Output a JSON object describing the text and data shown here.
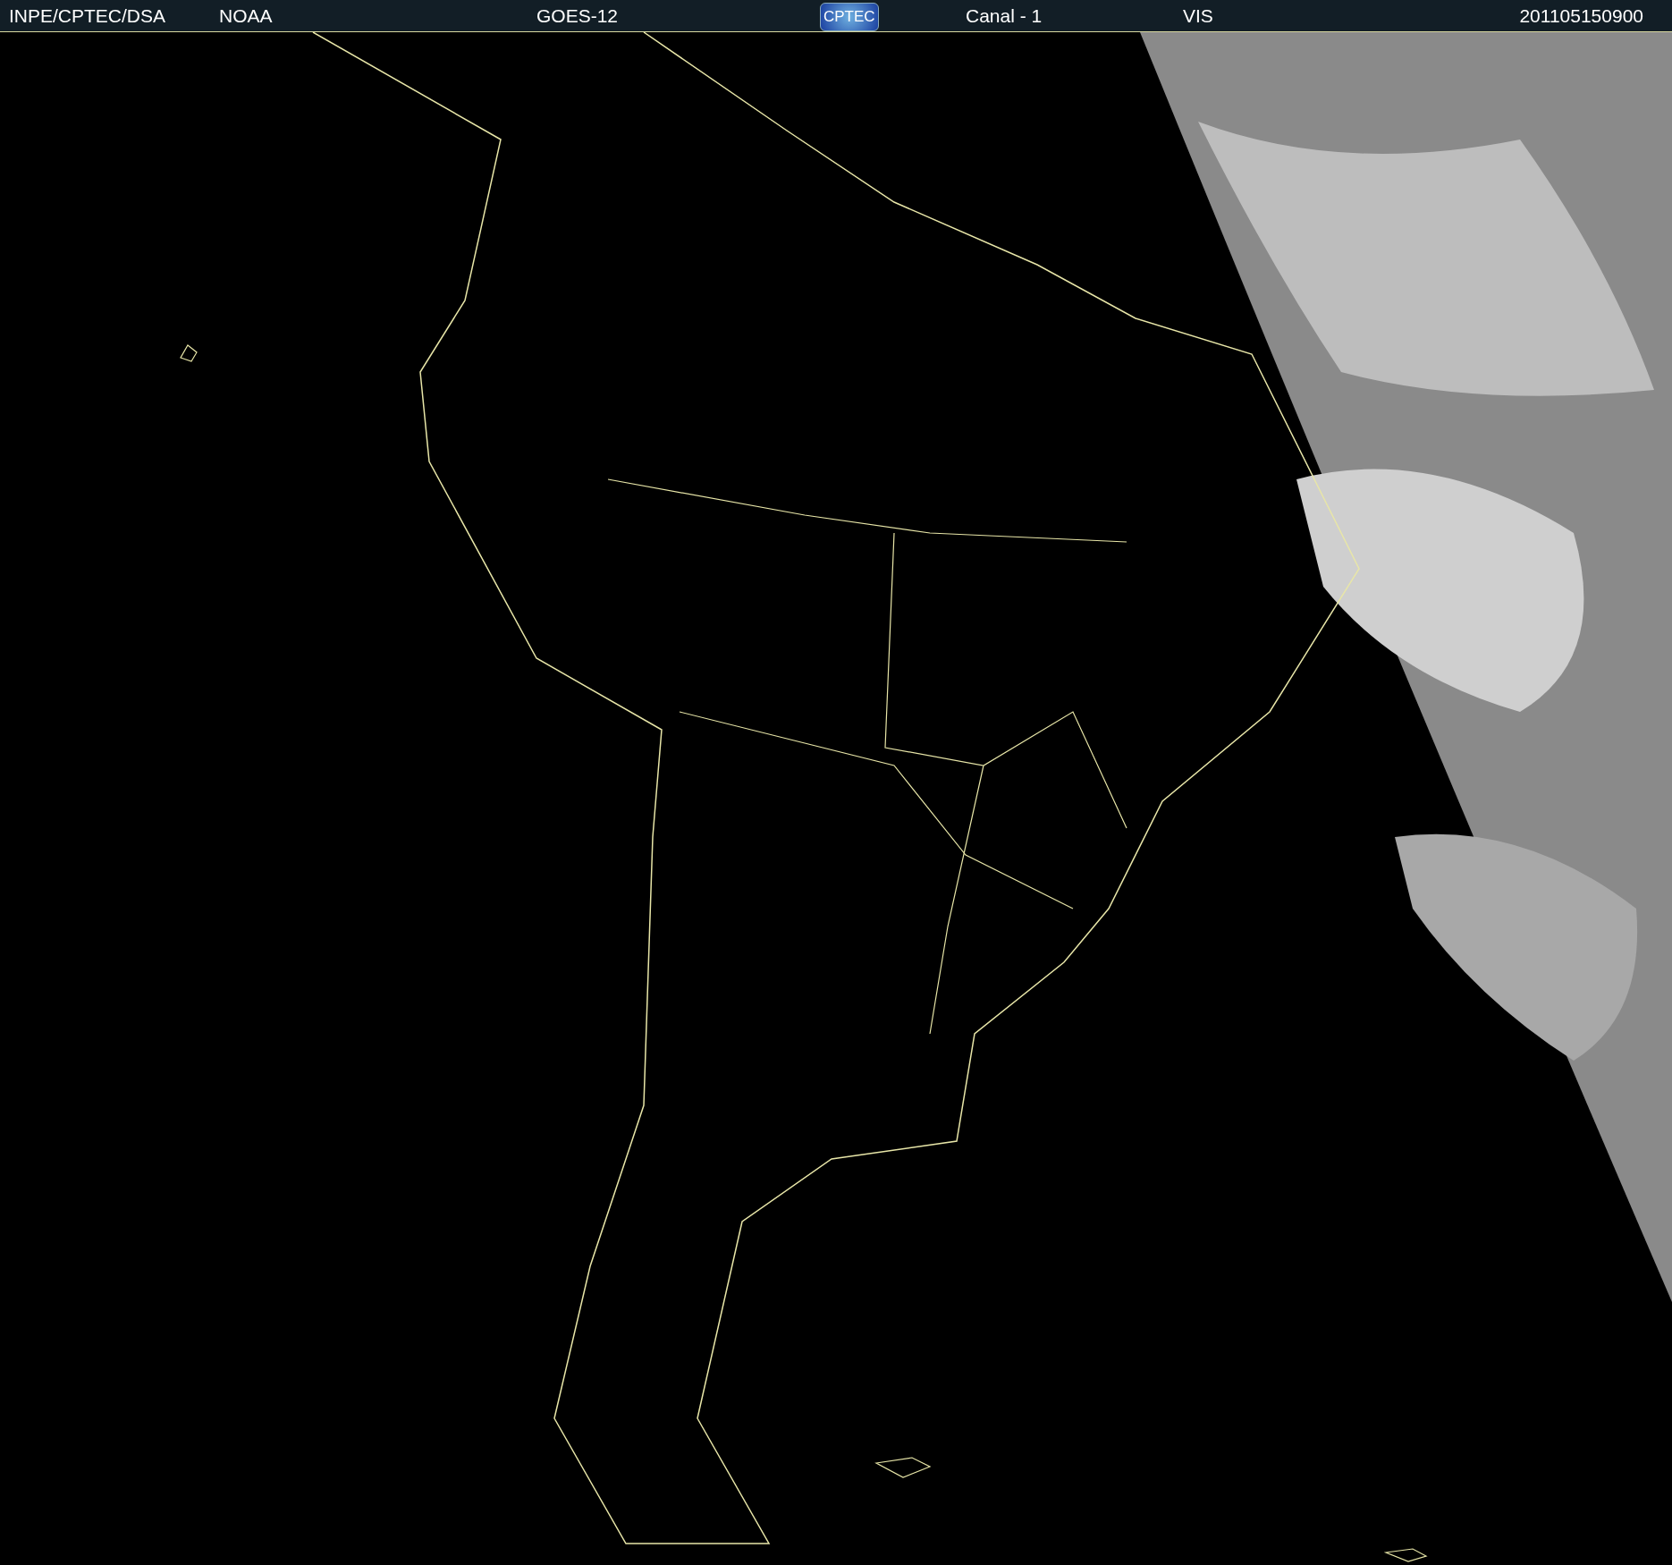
{
  "header": {
    "source": "INPE/CPTEC/DSA",
    "agency": "NOAA",
    "satellite": "GOES-12",
    "logo": "CPTEC",
    "channel": "Canal - 1",
    "band": "VIS",
    "timestamp": "201105150900"
  }
}
